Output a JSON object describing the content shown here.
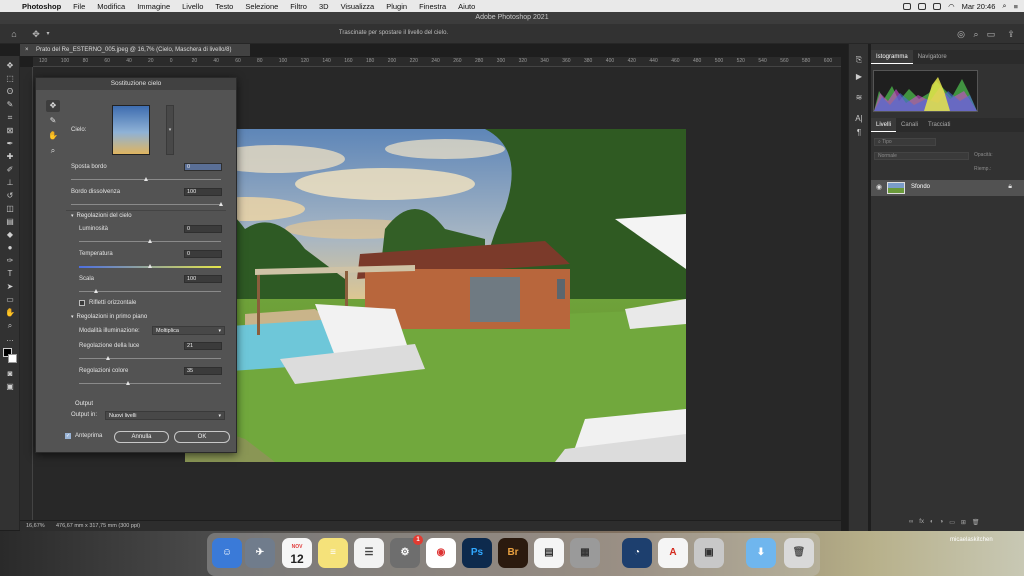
{
  "menubar": {
    "items": [
      "Photoshop",
      "File",
      "Modifica",
      "Immagine",
      "Livello",
      "Testo",
      "Selezione",
      "Filtro",
      "3D",
      "Visualizza",
      "Plugin",
      "Finestra",
      "Aiuto"
    ],
    "clock": "Mar 20:46"
  },
  "window_title": "Adobe Photoshop 2021",
  "options_hint": "Trascinate per spostare il livello del cielo.",
  "doc_tab": "Prato del Re_ESTERNO_005.jpeg @ 16,7% (Cielo, Maschera di livello/8)",
  "ruler_ticks": [
    "120",
    "100",
    "80",
    "60",
    "40",
    "20",
    "0",
    "20",
    "40",
    "60",
    "80",
    "100",
    "120",
    "140",
    "160",
    "180",
    "200",
    "220",
    "240",
    "260",
    "280",
    "300",
    "320",
    "340",
    "360",
    "380",
    "400",
    "420",
    "440",
    "460",
    "480",
    "500",
    "520",
    "540",
    "560",
    "580",
    "600"
  ],
  "status": {
    "zoom": "16,67%",
    "doc_info": "476,67 mm x 317,75 mm (300 ppi)"
  },
  "panels": {
    "top_tabs": [
      "Istogramma",
      "Navigatore"
    ],
    "layer_tabs": [
      "Livelli",
      "Canali",
      "Tracciati"
    ],
    "search_placeholder": "Tipo",
    "blend_mode": "Normale",
    "opacity_label": "Opacità:",
    "fill_label": "Riemp.:",
    "layer_name": "Sfondo",
    "footer_icons": [
      "link-icon",
      "fx-icon",
      "mask-icon",
      "adjustment-icon",
      "group-icon",
      "new-layer-icon",
      "trash-icon"
    ]
  },
  "dialog": {
    "title": "Sostituzione cielo",
    "sky_label": "Cielo:",
    "fields": {
      "sposta_bordo": {
        "label": "Sposta bordo",
        "value": "0",
        "level": 0.5
      },
      "bordo_dissolvenza": {
        "label": "Bordo dissolvenza",
        "value": "100",
        "level": 1.0
      },
      "luminosita": {
        "label": "Luminosità",
        "value": "0",
        "level": 0.5
      },
      "temperatura": {
        "label": "Temperatura",
        "value": "0",
        "level": 0.5
      },
      "scala": {
        "label": "Scala",
        "value": "100",
        "level": 0.12
      },
      "regolazione_luce": {
        "label": "Regolazione della luce",
        "value": "21",
        "level": 0.21
      },
      "regolazioni_colore": {
        "label": "Regolazioni colore",
        "value": "35",
        "level": 0.35
      }
    },
    "sky_section": "Regolazioni del cielo",
    "flip_label": "Rifletti orizzontale",
    "fg_section": "Regolazioni in primo piano",
    "lighting_mode_label": "Modalità illuminazione:",
    "lighting_mode_value": "Moltiplica",
    "output_section": "Output",
    "output_in_label": "Output in:",
    "output_in_value": "Nuovi livelli",
    "preview_label": "Anteprima",
    "cancel_label": "Annulla",
    "ok_label": "OK"
  },
  "dock": {
    "calendar_month": "NOV",
    "calendar_day": "12",
    "badge": "1",
    "watermark": "micaelaskitchen"
  }
}
